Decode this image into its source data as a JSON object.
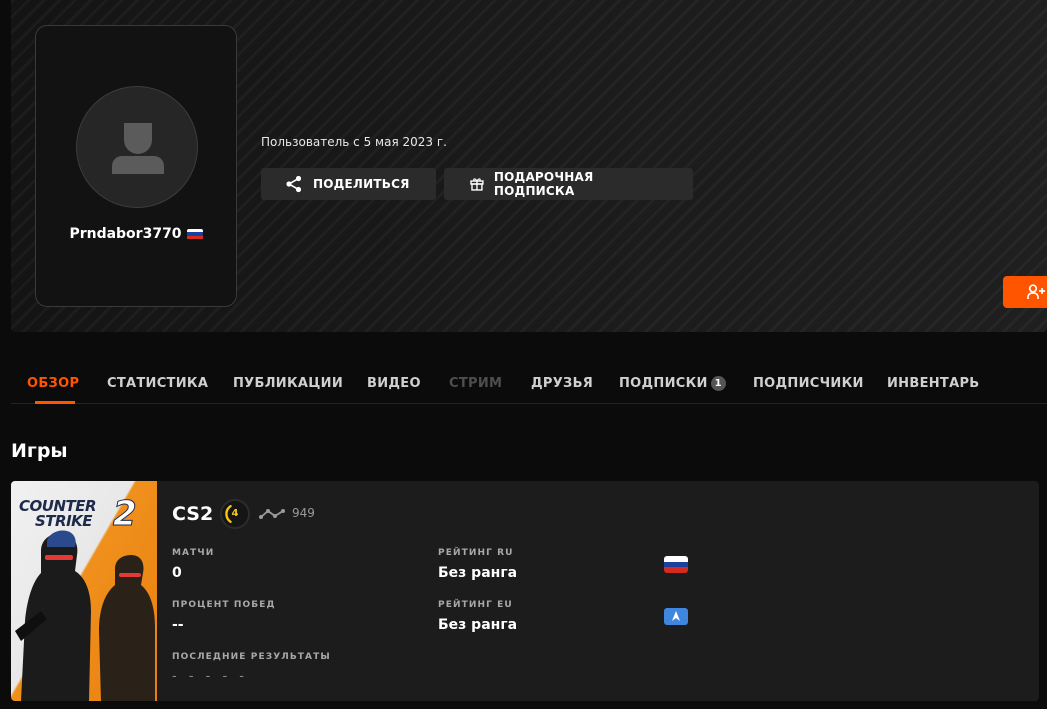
{
  "profile": {
    "username": "Prndabor3770",
    "member_since": "Пользователь с 5 мая 2023 г.",
    "share_label": "ПОДЕЛИТЬСЯ",
    "gift_label": "ПОДАРОЧНАЯ ПОДПИСКА"
  },
  "tabs": [
    {
      "label": "ОБЗОР",
      "state": "active"
    },
    {
      "label": "СТАТИСТИКА"
    },
    {
      "label": "ПУБЛИКАЦИИ"
    },
    {
      "label": "ВИДЕО"
    },
    {
      "label": "СТРИМ",
      "state": "disabled"
    },
    {
      "label": "ДРУЗЬЯ"
    },
    {
      "label": "ПОДПИСКИ",
      "badge": "1"
    },
    {
      "label": "ПОДПИСЧИКИ"
    },
    {
      "label": "ИНВЕНТАРЬ"
    }
  ],
  "games": {
    "title": "Игры",
    "card": {
      "logo_line1": "COUNTER",
      "logo_line2": "STRIKE",
      "logo_number": "2",
      "name": "CS2",
      "level": "4",
      "elo": "949",
      "matches_label": "МАТЧИ",
      "matches_value": "0",
      "winrate_label": "ПРОЦЕНТ ПОБЕД",
      "winrate_value": "--",
      "recent_label": "ПОСЛЕДНИЕ РЕЗУЛЬТАТЫ",
      "recent_value": "- - - - -",
      "rating_ru_label": "РЕЙТИНГ RU",
      "rating_ru_value": "Без ранга",
      "rating_eu_label": "РЕЙТИНГ EU",
      "rating_eu_value": "Без ранга"
    }
  },
  "colors": {
    "accent": "#ff5500",
    "level": "#f5c518",
    "flag_white": "#ffffff",
    "flag_blue": "#1c3f9e",
    "flag_red": "#d52b1e",
    "eu_flag": "#3f86de"
  },
  "icons": {
    "avatar": "default-user-icon",
    "share": "share-icon",
    "gift": "gift-icon",
    "add_friend": "add-user-icon",
    "elo": "elo-trend-icon"
  }
}
